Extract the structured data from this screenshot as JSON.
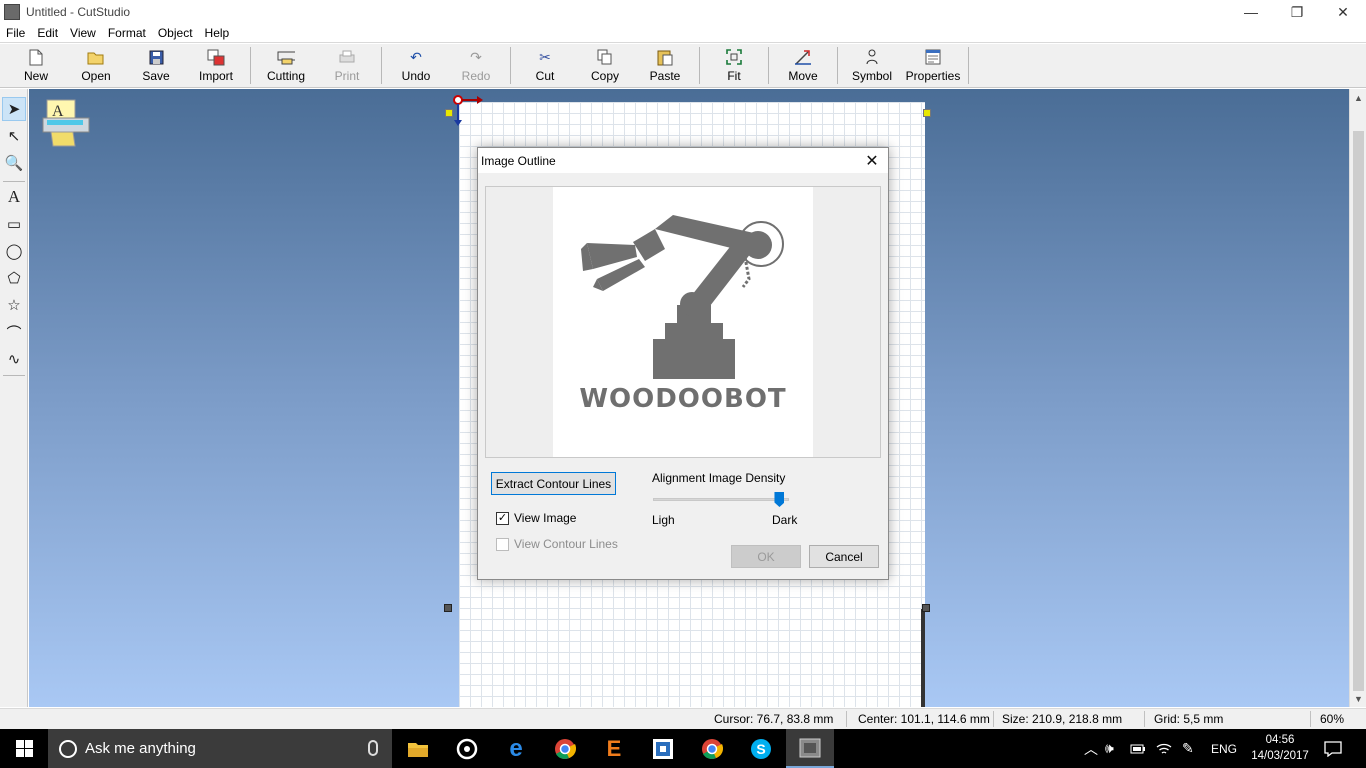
{
  "window": {
    "title": "Untitled - CutStudio",
    "minimize": "—",
    "restore": "❐",
    "close": "✕"
  },
  "menu": [
    "File",
    "Edit",
    "View",
    "Format",
    "Object",
    "Help"
  ],
  "toolbar": {
    "new": "New",
    "open": "Open",
    "save": "Save",
    "import": "Import",
    "cutting": "Cutting",
    "print": "Print",
    "undo": "Undo",
    "redo": "Redo",
    "cut": "Cut",
    "copy": "Copy",
    "paste": "Paste",
    "fit": "Fit",
    "move": "Move",
    "symbol": "Symbol",
    "properties": "Properties"
  },
  "palette": {
    "select": "➤",
    "node_edit": "↖",
    "zoom": "🔍",
    "text": "A",
    "rectangle": "▭",
    "ellipse": "◯",
    "polygon": "⬠",
    "star": "☆",
    "polyline": "⌒",
    "curve": "∿"
  },
  "dialog": {
    "title": "Image Outline",
    "close": "✕",
    "extract_button": "Extract Contour Lines",
    "density_label": "Alignment Image Density",
    "light_label": "Ligh",
    "dark_label": "Dark",
    "density_level": 0.93,
    "view_image": "View Image",
    "view_image_checked": true,
    "view_contour": "View Contour Lines",
    "view_contour_checked": false,
    "ok": "OK",
    "cancel": "Cancel",
    "preview_text": "WOODOOBOT"
  },
  "status": {
    "cursor": "Cursor: 76.7, 83.8 mm",
    "center": "Center: 101.1, 114.6 mm",
    "size": "Size: 210.9, 218.8 mm",
    "grid": "Grid: 5,5 mm",
    "zoom": "60%"
  },
  "taskbar": {
    "search_placeholder": "Ask me anything",
    "language": "ENG",
    "time": "04:56",
    "date": "14/03/2017"
  },
  "colors": {
    "accent": "#0078d7",
    "canvas_top": "#4a6d96",
    "canvas_bottom": "#a9c8f4",
    "robot": "#6f6f6f"
  }
}
